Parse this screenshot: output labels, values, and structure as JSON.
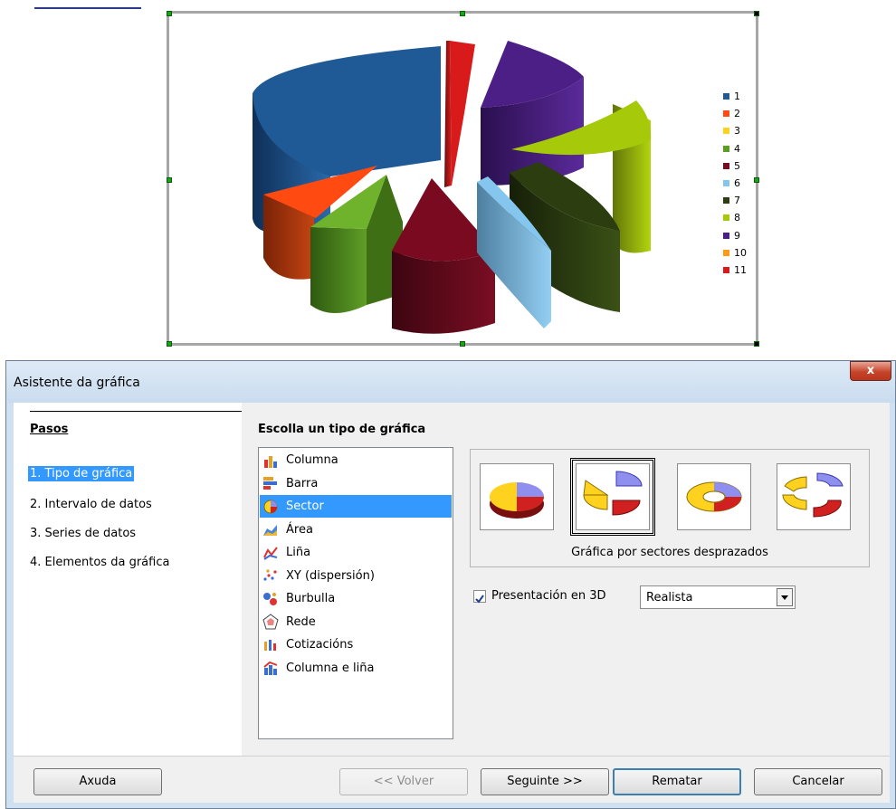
{
  "chart": {
    "legend": [
      "1",
      "2",
      "3",
      "4",
      "5",
      "6",
      "7",
      "8",
      "9",
      "10",
      "11"
    ],
    "colors": {
      "1": "#1f5a96",
      "2": "#ff4a12",
      "3": "#ffd21f",
      "4": "#5a9e22",
      "5": "#7a0a1f",
      "6": "#84c6ee",
      "7": "#2c3d10",
      "8": "#a6c90a",
      "9": "#4b1f86",
      "10": "#ff9a12",
      "11": "#d81a1a"
    }
  },
  "dialog": {
    "title": "Asistente da gráfica",
    "close_label": "x",
    "steps_title": "Pasos",
    "steps": [
      {
        "label": "1. Tipo de gráfica",
        "active": true
      },
      {
        "label": "2. Intervalo de datos",
        "active": false
      },
      {
        "label": "3. Series de datos",
        "active": false
      },
      {
        "label": "4. Elementos da gráfica",
        "active": false
      }
    ],
    "type_title": "Escolla un tipo de gráfica",
    "chart_types": [
      {
        "label": "Columna",
        "icon": "column-chart-icon",
        "selected": false
      },
      {
        "label": "Barra",
        "icon": "bar-chart-icon",
        "selected": false
      },
      {
        "label": "Sector",
        "icon": "pie-chart-icon",
        "selected": true
      },
      {
        "label": "Área",
        "icon": "area-chart-icon",
        "selected": false
      },
      {
        "label": "Liña",
        "icon": "line-chart-icon",
        "selected": false
      },
      {
        "label": "XY (dispersión)",
        "icon": "scatter-chart-icon",
        "selected": false
      },
      {
        "label": "Burbulla",
        "icon": "bubble-chart-icon",
        "selected": false
      },
      {
        "label": "Rede",
        "icon": "net-chart-icon",
        "selected": false
      },
      {
        "label": "Cotizacións",
        "icon": "stock-chart-icon",
        "selected": false
      },
      {
        "label": "Columna e liña",
        "icon": "column-line-chart-icon",
        "selected": false
      }
    ],
    "variant_caption": "Gráfica por sectores desprazados",
    "checkbox_3d": {
      "label": "Presentación en 3D",
      "checked": true
    },
    "select_3d": {
      "value": "Realista"
    },
    "buttons": {
      "help": "Axuda",
      "back": "<< Volver",
      "next": "Seguinte >>",
      "finish": "Rematar",
      "cancel": "Cancelar"
    }
  }
}
